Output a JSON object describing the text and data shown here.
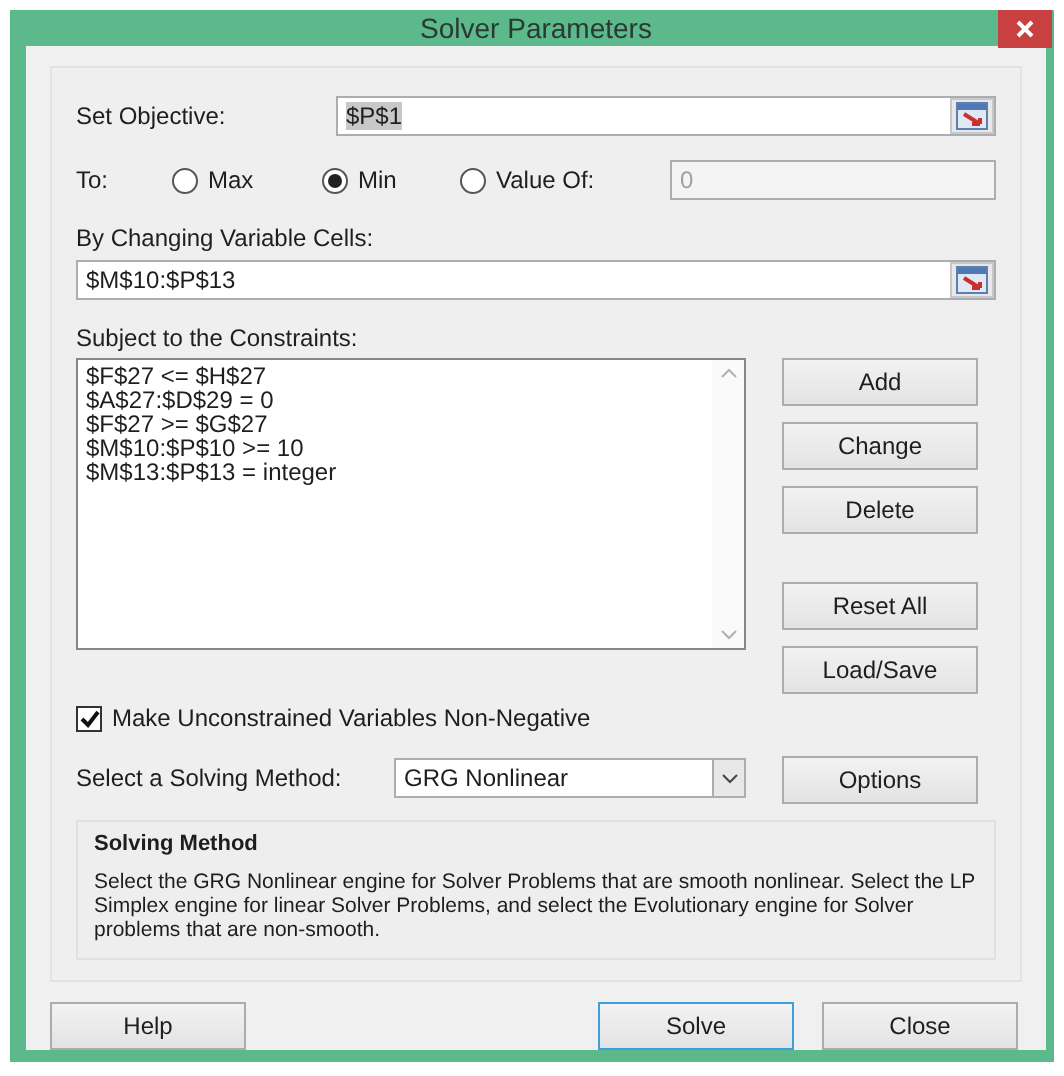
{
  "window": {
    "title": "Solver Parameters"
  },
  "objective": {
    "label": "Set Objective:",
    "value": "$P$1",
    "highlighted": true
  },
  "to": {
    "label": "To:",
    "options": [
      {
        "label": "Max",
        "selected": false
      },
      {
        "label": "Min",
        "selected": true
      },
      {
        "label": "Value Of:",
        "selected": false
      }
    ],
    "value_field": {
      "value": "0",
      "disabled": true
    }
  },
  "variable_cells": {
    "label": "By Changing Variable Cells:",
    "value": "$M$10:$P$13"
  },
  "constraints": {
    "label": "Subject to the Constraints:",
    "items": [
      "$F$27 <= $H$27",
      "$A$27:$D$29 = 0",
      "$F$27 >= $G$27",
      "$M$10:$P$10 >= 10",
      "$M$13:$P$13 = integer"
    ]
  },
  "edit_buttons": [
    "Add",
    "Change",
    "Delete"
  ],
  "file_buttons": [
    "Reset All",
    "Load/Save"
  ],
  "non_negative": {
    "label": "Make Unconstrained Variables Non-Negative",
    "checked": true
  },
  "method": {
    "label": "Select a Solving Method:",
    "value": "GRG Nonlinear",
    "button": "Options"
  },
  "description": {
    "title": "Solving Method",
    "text": "Select the GRG Nonlinear engine for Solver Problems that are smooth nonlinear. Select the LP Simplex engine for linear Solver Problems, and select the Evolutionary engine for Solver problems that are non-smooth."
  },
  "footer": [
    {
      "label": "Help",
      "default": false
    },
    {
      "label": "Solve",
      "default": true
    },
    {
      "label": "Close",
      "default": false
    }
  ]
}
